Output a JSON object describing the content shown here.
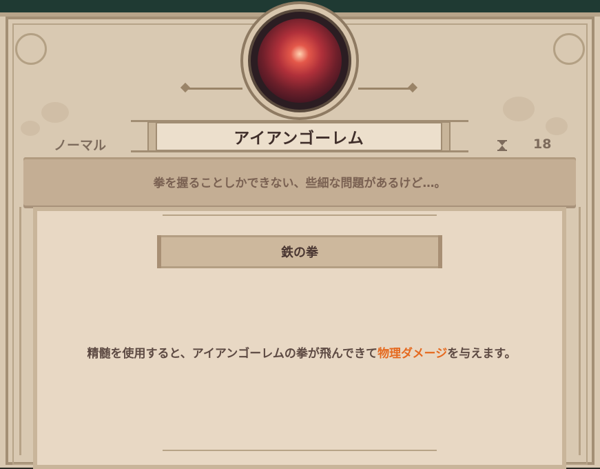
{
  "card": {
    "name": "アイアンゴーレム",
    "rarity": "ノーマル",
    "cost": "18",
    "flavor": "拳を握ることしかできない、些細な問題があるけど…。",
    "skill": {
      "title": "鉄の拳",
      "desc_before": "精髄を使用すると、アイアンゴーレムの拳が飛んできて",
      "desc_highlight": "物理ダメージ",
      "desc_after": "を与えます。"
    }
  },
  "colors": {
    "parchment": "#d9c9b2",
    "panel": "#e8d8c4",
    "highlight": "#e5691f",
    "gem": "#b0303a"
  },
  "icons": {
    "gem": "red-orb-icon",
    "cost": "hourglass-icon"
  }
}
